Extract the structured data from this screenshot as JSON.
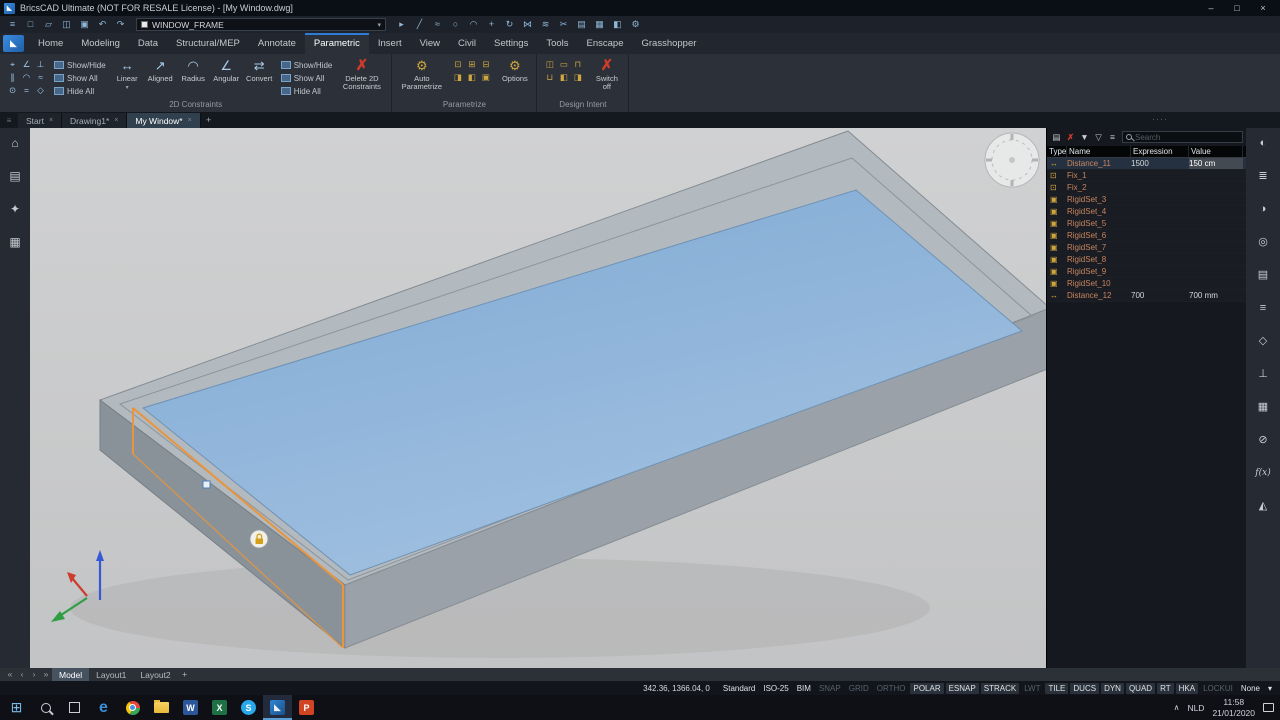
{
  "colors": {
    "accent": "#2f7cd6",
    "highlight_orange": "#e8953c",
    "delete_red": "#d23b2a",
    "name_text": "#c9845e",
    "gold": "#d0a63f",
    "glass": "#86afd8",
    "frame_top": "#b2b9bf",
    "viewport_bg": "#c9cacb"
  },
  "title_bar": {
    "logo_glyph": "◣",
    "title": "BricsCAD Ultimate (NOT FOR RESALE License) - [My Window.dwg]",
    "minimize": "–",
    "maximize": "□",
    "close": "×"
  },
  "quick_access": {
    "left_icons": [
      {
        "n": "app-menu-icon",
        "g": "≡"
      },
      {
        "n": "new-file-icon",
        "g": "□"
      },
      {
        "n": "open-file-icon",
        "g": "▱"
      },
      {
        "n": "save-icon",
        "g": "◫"
      },
      {
        "n": "print-icon",
        "g": "▣"
      },
      {
        "n": "undo-icon",
        "g": "↶"
      },
      {
        "n": "redo-icon",
        "g": "↷"
      }
    ],
    "layer_combo": "WINDOW_FRAME",
    "combo_arrow": "▾",
    "right_icons": [
      {
        "n": "cursor-icon",
        "g": "▸"
      },
      {
        "n": "line-icon",
        "g": "╱"
      },
      {
        "n": "polyline-icon",
        "g": "≈"
      },
      {
        "n": "circle-icon",
        "g": "○"
      },
      {
        "n": "arc-icon",
        "g": "◠"
      },
      {
        "n": "move-icon",
        "g": "+"
      },
      {
        "n": "rotate-icon",
        "g": "↻"
      },
      {
        "n": "mirror-icon",
        "g": "⋈"
      },
      {
        "n": "offset-icon",
        "g": "≋"
      },
      {
        "n": "trim-icon",
        "g": "✂"
      },
      {
        "n": "layers-icon",
        "g": "▤"
      },
      {
        "n": "named-views-icon",
        "g": "▦"
      },
      {
        "n": "render-icon",
        "g": "◧"
      },
      {
        "n": "settings-icon",
        "g": "⚙"
      }
    ]
  },
  "ribbon": {
    "tabs": [
      {
        "label": "Home"
      },
      {
        "label": "Modeling"
      },
      {
        "label": "Data"
      },
      {
        "label": "Structural/MEP"
      },
      {
        "label": "Annotate"
      },
      {
        "label": "Parametric",
        "cls": "active"
      },
      {
        "label": "Insert"
      },
      {
        "label": "View"
      },
      {
        "label": "Civil"
      },
      {
        "label": "Settings"
      },
      {
        "label": "Tools"
      },
      {
        "label": "Enscape"
      },
      {
        "label": "Grasshopper"
      }
    ],
    "groups": {
      "c2d": {
        "label": "2D Constraints",
        "tiny_icons": [
          {
            "n": "coincident-constraint-icon",
            "g": "⌖"
          },
          {
            "n": "angle-constraint-icon",
            "g": "∠"
          },
          {
            "n": "perpendicular-constraint-icon",
            "g": "⊥"
          },
          {
            "n": "parallel-constraint-icon",
            "g": "∥"
          },
          {
            "n": "tangent-constraint-icon",
            "g": "◠"
          },
          {
            "n": "symmetric-constraint-icon",
            "g": "≈"
          },
          {
            "n": "concentric-constraint-icon",
            "g": "⊙"
          },
          {
            "n": "equal-constraint-icon",
            "g": "="
          },
          {
            "n": "fix-constraint-icon",
            "g": "◇"
          }
        ],
        "toggles_a": [
          {
            "label": "Show/Hide"
          },
          {
            "label": "Show All"
          },
          {
            "label": "Hide All"
          }
        ],
        "big_buttons": [
          {
            "label": "Linear",
            "g": "↔",
            "dd": "▾"
          },
          {
            "label": "Aligned",
            "g": "↗"
          },
          {
            "label": "Radius",
            "g": "◠"
          },
          {
            "label": "Angular",
            "g": "∠"
          },
          {
            "label": "Convert",
            "g": "⇄"
          }
        ],
        "toggles_b": [
          {
            "label": "Show/Hide"
          },
          {
            "label": "Show All"
          },
          {
            "label": "Hide All"
          }
        ],
        "delete_icon": "✗",
        "delete_label": "Delete 2D Constraints"
      },
      "param": {
        "label": "Parametrize",
        "auto_icon": "⚙",
        "auto_label": "Auto Parametrize",
        "tiny_icons": [
          {
            "n": "parametrize-lock-icon",
            "g": "⊡"
          },
          {
            "n": "parametrize-unlock-icon",
            "g": "⊞"
          },
          {
            "n": "parametrize-linear-icon",
            "g": "⊟"
          },
          {
            "n": "parametrize-radial-icon",
            "g": "◨"
          },
          {
            "n": "parametrize-angle-icon",
            "g": "◧"
          },
          {
            "n": "parametrize-table-icon",
            "g": "▣"
          }
        ],
        "options_icon": "⚙",
        "options_label": "Options"
      },
      "intent": {
        "label": "Design Intent",
        "tiny_icons": [
          {
            "n": "intent-coplanar-icon",
            "g": "◫"
          },
          {
            "n": "intent-coaxial-icon",
            "g": "▭"
          },
          {
            "n": "intent-equal-icon",
            "g": "⊓"
          },
          {
            "n": "intent-offset-icon",
            "g": "⊔"
          },
          {
            "n": "intent-symmetry-icon",
            "g": "◧"
          },
          {
            "n": "intent-rigid-icon",
            "g": "◨"
          }
        ],
        "switch_icon": "✗",
        "switch_label": "Switch off"
      }
    }
  },
  "doc_tabs": {
    "menu_icon": "≡",
    "tabs": [
      {
        "label": "Start",
        "close": "×"
      },
      {
        "label": "Drawing1*",
        "close": "×"
      },
      {
        "label": "My Window*",
        "close": "×",
        "cls": "active"
      }
    ],
    "add": "+",
    "grip": "····"
  },
  "left_strip": {
    "icons": [
      {
        "n": "home-icon",
        "g": "⌂"
      },
      {
        "n": "sheet-sets-icon",
        "g": "▤"
      },
      {
        "n": "favorites-icon",
        "g": "✦"
      },
      {
        "n": "library-icon",
        "g": "▦"
      }
    ]
  },
  "right_panel": {
    "toolbar": [
      {
        "n": "add-parameter-icon",
        "g": "▤"
      },
      {
        "n": "delete-parameter-icon",
        "g": "✗",
        "cls": "red"
      },
      {
        "n": "filter-expressions-icon",
        "g": "▼"
      },
      {
        "n": "filter-parameters-icon",
        "g": "▽"
      },
      {
        "n": "group-by-icon",
        "g": "≡"
      }
    ],
    "search_placeholder": "Search",
    "columns": [
      "Type",
      "Name",
      "Expression",
      "Value"
    ],
    "rows": [
      {
        "g": "↔",
        "name": "Distance_11",
        "expression": "1500",
        "value": "150 cm",
        "cls": "selected"
      },
      {
        "g": "⊡",
        "name": "Fix_1",
        "expression": "",
        "value": ""
      },
      {
        "g": "⊡",
        "name": "Fix_2",
        "expression": "",
        "value": ""
      },
      {
        "g": "▣",
        "name": "RigidSet_3",
        "expression": "",
        "value": ""
      },
      {
        "g": "▣",
        "name": "RigidSet_4",
        "expression": "",
        "value": ""
      },
      {
        "g": "▣",
        "name": "RigidSet_5",
        "expression": "",
        "value": ""
      },
      {
        "g": "▣",
        "name": "RigidSet_6",
        "expression": "",
        "value": ""
      },
      {
        "g": "▣",
        "name": "RigidSet_7",
        "expression": "",
        "value": ""
      },
      {
        "g": "▣",
        "name": "RigidSet_8",
        "expression": "",
        "value": ""
      },
      {
        "g": "▣",
        "name": "RigidSet_9",
        "expression": "",
        "value": ""
      },
      {
        "g": "▣",
        "name": "RigidSet_10",
        "expression": "",
        "value": ""
      },
      {
        "g": "↔",
        "name": "Distance_12",
        "expression": "700",
        "value": "700 mm"
      }
    ]
  },
  "right_strip": {
    "icons": [
      {
        "n": "properties-panel-icon",
        "g": "◐"
      },
      {
        "n": "layers-panel-icon",
        "g": "≣"
      },
      {
        "n": "materials-panel-icon",
        "g": "◑"
      },
      {
        "n": "render-panel-icon",
        "g": "◎"
      },
      {
        "n": "sheets-panel-icon",
        "g": "▤"
      },
      {
        "n": "structure-panel-icon",
        "g": "≡"
      },
      {
        "n": "components-panel-icon",
        "g": "◇"
      },
      {
        "n": "sections-panel-icon",
        "g": "⊥"
      },
      {
        "n": "detail-panel-icon",
        "g": "▦"
      },
      {
        "n": "attachments-panel-icon",
        "g": "⊘"
      },
      {
        "n": "mechanical-browser-panel-icon",
        "g": "f(x)",
        "cls": "fx"
      },
      {
        "n": "bim-profiles-panel-icon",
        "g": "◭"
      }
    ]
  },
  "layout_bar": {
    "nav": [
      {
        "n": "first-layout-icon",
        "g": "«"
      },
      {
        "n": "prev-layout-icon",
        "g": "‹"
      },
      {
        "n": "next-layout-icon",
        "g": "›"
      },
      {
        "n": "last-layout-icon",
        "g": "»"
      }
    ],
    "tabs": [
      {
        "label": "Model",
        "cls": "active"
      },
      {
        "label": "Layout1"
      },
      {
        "label": "Layout2"
      }
    ],
    "add": "+"
  },
  "status_bar": {
    "coords": "342.36, 1366.04, 0",
    "items": [
      {
        "label": "Standard",
        "cls": "on plain"
      },
      {
        "label": "ISO-25",
        "cls": "on plain"
      },
      {
        "label": "BIM",
        "cls": "on plain"
      },
      {
        "label": "SNAP",
        "cls": "off"
      },
      {
        "label": "GRID",
        "cls": "off"
      },
      {
        "label": "ORTHO",
        "cls": "off"
      },
      {
        "label": "POLAR",
        "cls": "on"
      },
      {
        "label": "ESNAP",
        "cls": "on"
      },
      {
        "label": "STRACK",
        "cls": "on"
      },
      {
        "label": "LWT",
        "cls": "off"
      },
      {
        "label": "TILE",
        "cls": "on"
      },
      {
        "label": "DUCS",
        "cls": "on"
      },
      {
        "label": "DYN",
        "cls": "on"
      },
      {
        "label": "QUAD",
        "cls": "on"
      },
      {
        "label": "RT",
        "cls": "on"
      },
      {
        "label": "HKA",
        "cls": "on"
      },
      {
        "label": "LOCKUI",
        "cls": "off"
      },
      {
        "label": "None",
        "cls": "on plain"
      },
      {
        "label": "▾",
        "cls": "on plain"
      }
    ]
  },
  "taskbar": {
    "apps": [
      {
        "n": "start-button",
        "cls": "start",
        "g": "⊞"
      },
      {
        "n": "search-button",
        "cls": "searchbtn",
        "g": ""
      },
      {
        "n": "task-view-button",
        "cls": "taskview",
        "g": ""
      },
      {
        "n": "edge-icon",
        "cls": "edge",
        "g": "e"
      },
      {
        "n": "chrome-icon",
        "cls": "chrome",
        "g": ""
      },
      {
        "n": "file-explorer-icon",
        "cls": "folder",
        "g": ""
      },
      {
        "n": "word-icon",
        "cls": "word",
        "g": "W"
      },
      {
        "n": "excel-icon",
        "cls": "excel",
        "g": "X"
      },
      {
        "n": "skype-icon",
        "cls": "skype",
        "g": "S"
      },
      {
        "n": "bricscad-taskbar-icon",
        "cls": "bricscad",
        "btncls": "active",
        "g": "◣"
      },
      {
        "n": "powerpoint-icon",
        "cls": "ppt",
        "g": "P"
      }
    ],
    "tray": {
      "expand_icon": "∧",
      "language": "NLD",
      "time": "11:58",
      "date": "21/01/2020"
    }
  }
}
